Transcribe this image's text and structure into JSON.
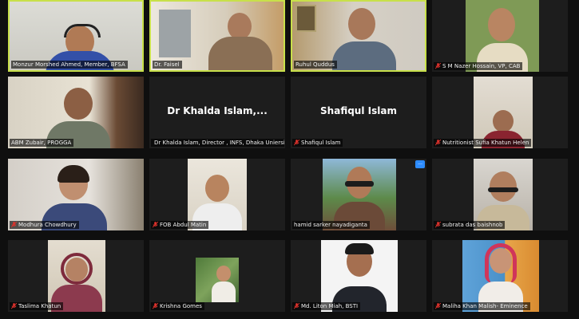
{
  "meeting": {
    "participants": [
      {
        "label": "Monzur Morshed Ahmed, Member, BFSA",
        "muted": false,
        "active": true
      },
      {
        "label": "Dr. Faisel",
        "muted": false,
        "active": true
      },
      {
        "label": "Ruhul Quddus",
        "muted": false,
        "active": true
      },
      {
        "label": "S M Nazer Hossain, VP, CAB",
        "muted": true,
        "active": false
      },
      {
        "label": "ABM Zubair, PROGGA",
        "muted": false,
        "active": false
      },
      {
        "label": "Dr Khalda Islam, Director , INFS, Dhaka Uniersi...",
        "big_name": "Dr Khalda Islam,...",
        "muted": true,
        "active": false
      },
      {
        "label": "Shafiqul Islam",
        "big_name": "Shafiqul Islam",
        "muted": true,
        "active": false
      },
      {
        "label": "Nutritionist Sufia Khatun Helen",
        "muted": true,
        "active": false
      },
      {
        "label": "Modhura Chowdhury",
        "muted": true,
        "active": false
      },
      {
        "label": "FOB Abdul Matin",
        "muted": true,
        "active": false
      },
      {
        "label": "hamid sarker nayadiganta",
        "muted": false,
        "active": false,
        "more": "..."
      },
      {
        "label": "subrata das baishnob",
        "muted": true,
        "active": false
      },
      {
        "label": "Taslima Khatun",
        "muted": true,
        "active": false
      },
      {
        "label": "Krishna Gomes",
        "muted": true,
        "active": false
      },
      {
        "label": "Md. Liton Miah, BSTI",
        "muted": true,
        "active": false
      },
      {
        "label": "Maliha Khan Malish- Eminence",
        "muted": true,
        "active": false
      }
    ]
  },
  "colors": {
    "active_border": "#c8e04a",
    "muted_icon": "#e0322c",
    "tile_bg": "#1d1d1d",
    "more_button": "#2d8cff"
  }
}
